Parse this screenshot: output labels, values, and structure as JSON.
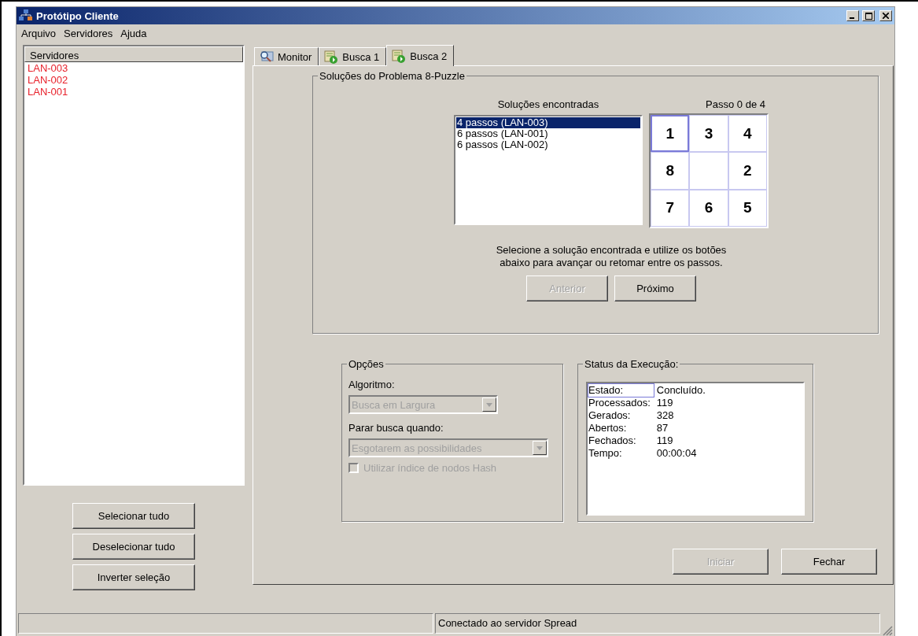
{
  "window": {
    "title": "Protótipo Cliente"
  },
  "menu": [
    {
      "label": "Arquivo"
    },
    {
      "label": "Servidores"
    },
    {
      "label": "Ajuda"
    }
  ],
  "servers": {
    "header": "Servidores",
    "items": [
      {
        "label": "LAN-003",
        "color": "#e8202a"
      },
      {
        "label": "LAN-002",
        "color": "#e8202a"
      },
      {
        "label": "LAN-001",
        "color": "#e8202a"
      }
    ]
  },
  "server_buttons": [
    "Selecionar tudo",
    "Deselecionar tudo",
    "Inverter seleção"
  ],
  "tabs": [
    {
      "label": "Monitor",
      "kind": "monitor",
      "selected": false
    },
    {
      "label": "Busca 1",
      "kind": "search",
      "selected": false
    },
    {
      "label": "Busca 2",
      "kind": "search",
      "selected": true
    }
  ],
  "solutions": {
    "title": "Soluções do Problema 8-Puzzle",
    "list_label": "Soluções encontradas",
    "items": [
      {
        "label": "4 passos (LAN-003)",
        "selected": true
      },
      {
        "label": "6 passos (LAN-001)",
        "selected": false
      },
      {
        "label": "6 passos (LAN-002)",
        "selected": false
      }
    ],
    "step_label": "Passo 0 de 4",
    "tiles": [
      {
        "kind": "number",
        "text": "1",
        "selected": true
      },
      {
        "kind": "number",
        "text": "3",
        "selected": false
      },
      {
        "kind": "number",
        "text": "4",
        "selected": false
      },
      {
        "kind": "number",
        "text": "8",
        "selected": false
      },
      {
        "kind": "blank",
        "selected": false
      },
      {
        "kind": "number",
        "text": "2",
        "selected": false
      },
      {
        "kind": "number",
        "text": "7",
        "selected": false
      },
      {
        "kind": "number",
        "text": "6",
        "selected": false
      },
      {
        "kind": "number",
        "text": "5",
        "selected": false
      }
    ],
    "instructions": [
      "Selecione a solução encontrada e utilize os botões",
      "abaixo para avançar ou retomar entre os passos."
    ],
    "buttons": [
      {
        "label": "Anterior",
        "disabled": true
      },
      {
        "label": "Próximo",
        "disabled": false
      }
    ]
  },
  "options": {
    "title": "Opções",
    "algorithm_label": "Algoritmo:",
    "algorithm": {
      "value": "Busca em Largura",
      "disabled": true
    },
    "stop_label": "Parar busca quando:",
    "stop": {
      "value": "Esgotarem as possibilidades",
      "disabled": true
    },
    "hash_checkbox": {
      "label": "Utilizar índice de nodos Hash",
      "checked": false,
      "disabled": true
    }
  },
  "status": {
    "title": "Status da Execução:",
    "rows": [
      {
        "label": "Estado:",
        "value": "Concluído."
      },
      {
        "label": "Processados:",
        "value": "119"
      },
      {
        "label": "Gerados:",
        "value": "328"
      },
      {
        "label": "Abertos:",
        "value": "87"
      },
      {
        "label": "Fechados:",
        "value": "119"
      },
      {
        "label": "Tempo:",
        "value": "00:00:04"
      }
    ]
  },
  "action_buttons": [
    {
      "label": "Iniciar",
      "disabled": true
    },
    {
      "label": "Fechar",
      "disabled": false
    }
  ],
  "status_bar": [
    "Conectado ao servidor Spread"
  ]
}
